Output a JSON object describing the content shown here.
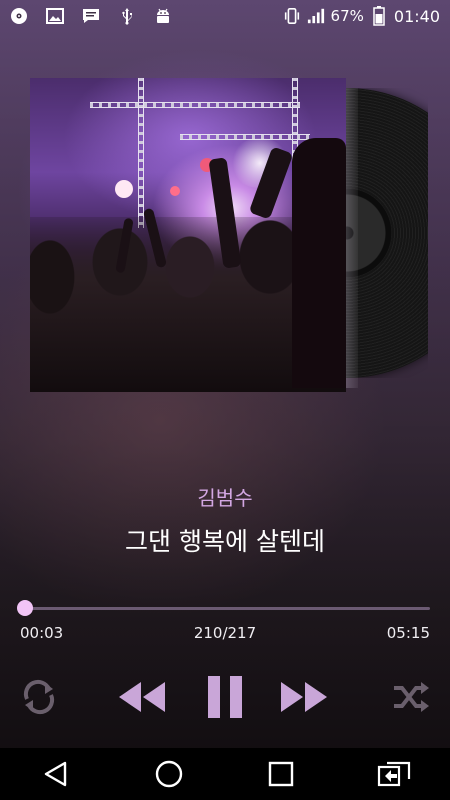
{
  "status_bar": {
    "left_icons": [
      "cd-icon",
      "image-icon",
      "message-icon",
      "usb-icon",
      "android-icon"
    ],
    "right_icons": [
      "vibrate-icon",
      "signal-icon"
    ],
    "battery": "67%",
    "time": "01:40"
  },
  "player": {
    "artist": "김범수",
    "song_title": "그댄 행복에 살텐데",
    "elapsed": "00:03",
    "track_position": "210/217",
    "duration": "05:15",
    "progress_fraction": 0.01,
    "controls": [
      "repeat-icon",
      "previous-icon",
      "pause-icon",
      "next-icon",
      "shuffle-icon"
    ]
  },
  "nav_bar": [
    "back",
    "home",
    "recents",
    "switch-app"
  ],
  "colors": {
    "accent": "#d9a6ee",
    "artist_text": "#d3a7e3",
    "control_main": "#c9a6d8",
    "control_dim": "#6a5f6c"
  }
}
